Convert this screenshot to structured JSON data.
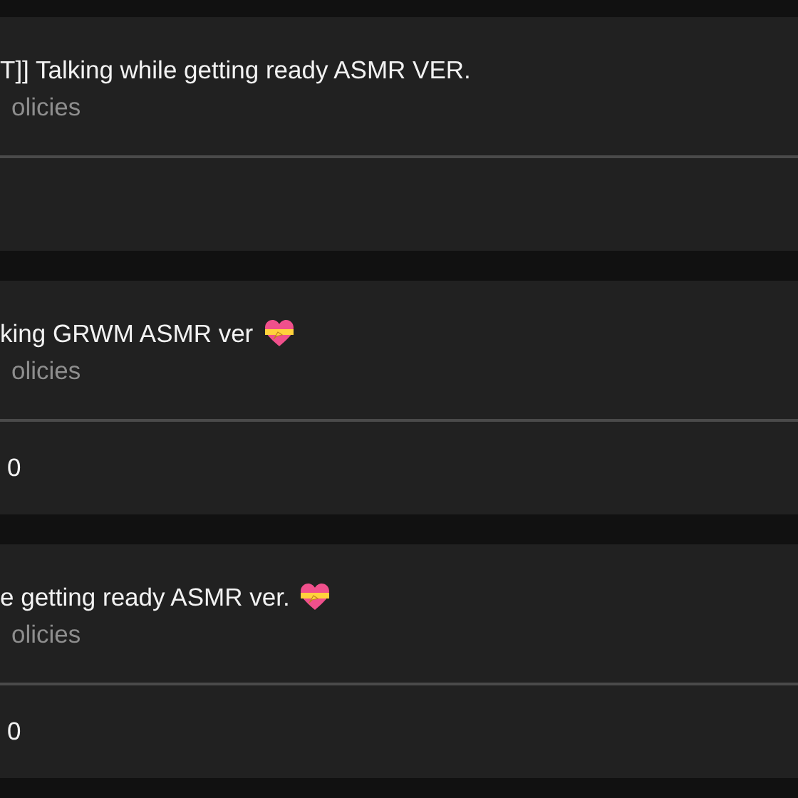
{
  "cards": [
    {
      "title": "T]] Talking while getting ready ASMR VER.",
      "emoji": false,
      "subtitle": "olicies"
    },
    {
      "title": "king GRWM ASMR ver",
      "emoji": true,
      "subtitle": "olicies",
      "footer": "0"
    },
    {
      "title": "e getting ready ASMR ver.",
      "emoji": true,
      "subtitle": "olicies",
      "footer": "0"
    }
  ]
}
